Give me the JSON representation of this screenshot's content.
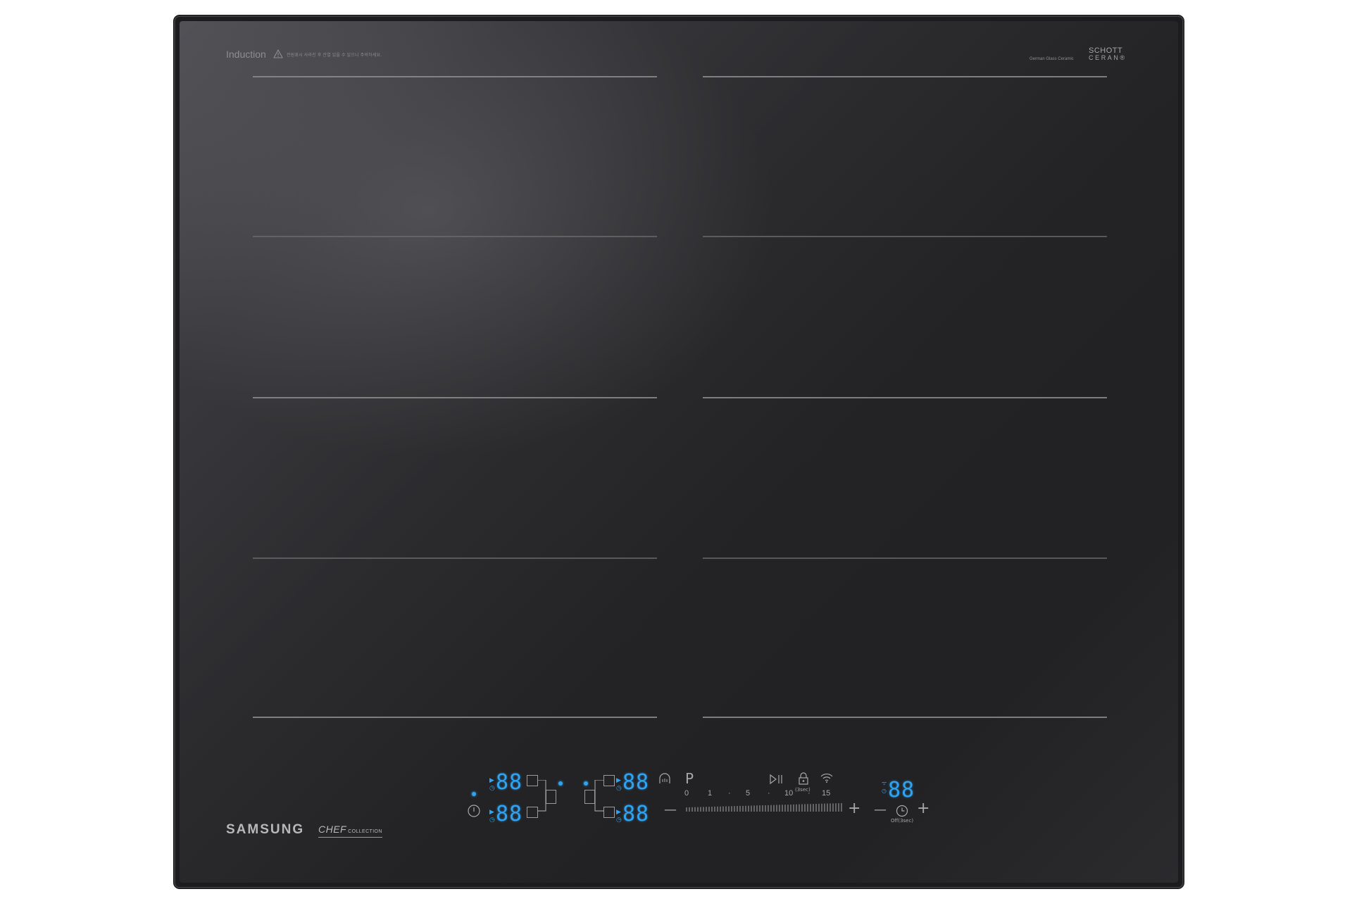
{
  "header": {
    "mode_label": "Induction",
    "warning_text": "전원표시 사라진 후 잔열 있을 수 있으니 주의하세요.",
    "glass_caption": "German Glass Ceramic",
    "glass_brand_line1": "SCHOTT",
    "glass_brand_line2": "CERAN®"
  },
  "brand": {
    "manufacturer": "SAMSUNG",
    "collection_main": "CHEF",
    "collection_sub": "COLLECTION"
  },
  "zones": {
    "front_left_display": "88",
    "rear_left_display": "88",
    "rear_right_display": "88",
    "front_right_display": "88"
  },
  "controls": {
    "program_label": "P",
    "minus_label": "—",
    "plus_label": "+",
    "slider_ticks": [
      "0",
      "1",
      "·",
      "5",
      "·",
      "10",
      "·",
      "15"
    ],
    "lock_caption": "(3sec)",
    "timer_display": "88",
    "timer_minus_label": "—",
    "timer_plus_label": "+",
    "timer_caption": "Off(3sec)"
  },
  "icons": {
    "power": "power-icon",
    "keep_warm": "keep-warm-icon",
    "pause": "play-pause-icon",
    "lock": "lock-icon",
    "wifi": "wifi-icon",
    "timer": "clock-icon"
  },
  "colors": {
    "display_blue": "#2fa3f2",
    "glass": "#232325",
    "line": "#8d8d90"
  }
}
